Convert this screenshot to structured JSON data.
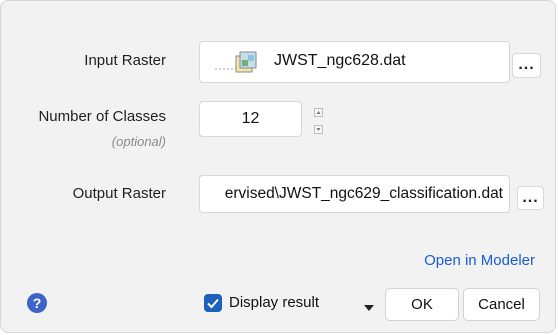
{
  "input_raster": {
    "label": "Input Raster",
    "value": "JWST_ngc628.dat",
    "browse_label": "...",
    "file_icon": "raster-file-icon"
  },
  "number_of_classes": {
    "label": "Number of Classes",
    "optional_hint": "(optional)",
    "value": "12",
    "increment_icon": "spin-up-icon",
    "decrement_icon": "spin-down-icon"
  },
  "output_raster": {
    "label": "Output Raster",
    "value": "ervised\\JWST_ngc629_classification.dat",
    "browse_label": "..."
  },
  "open_in_modeler": "Open in Modeler",
  "footer": {
    "help_icon": "help-icon",
    "display_result_label": "Display result",
    "display_result_checked": true,
    "dropdown_icon": "caret-down-icon",
    "ok_label": "OK",
    "cancel_label": "Cancel"
  },
  "colors": {
    "dialog_background": "#f2f2f2",
    "link": "#1a5bd0",
    "checkbox_accent": "#1c5fbd",
    "help_icon": "#3d64c8"
  }
}
